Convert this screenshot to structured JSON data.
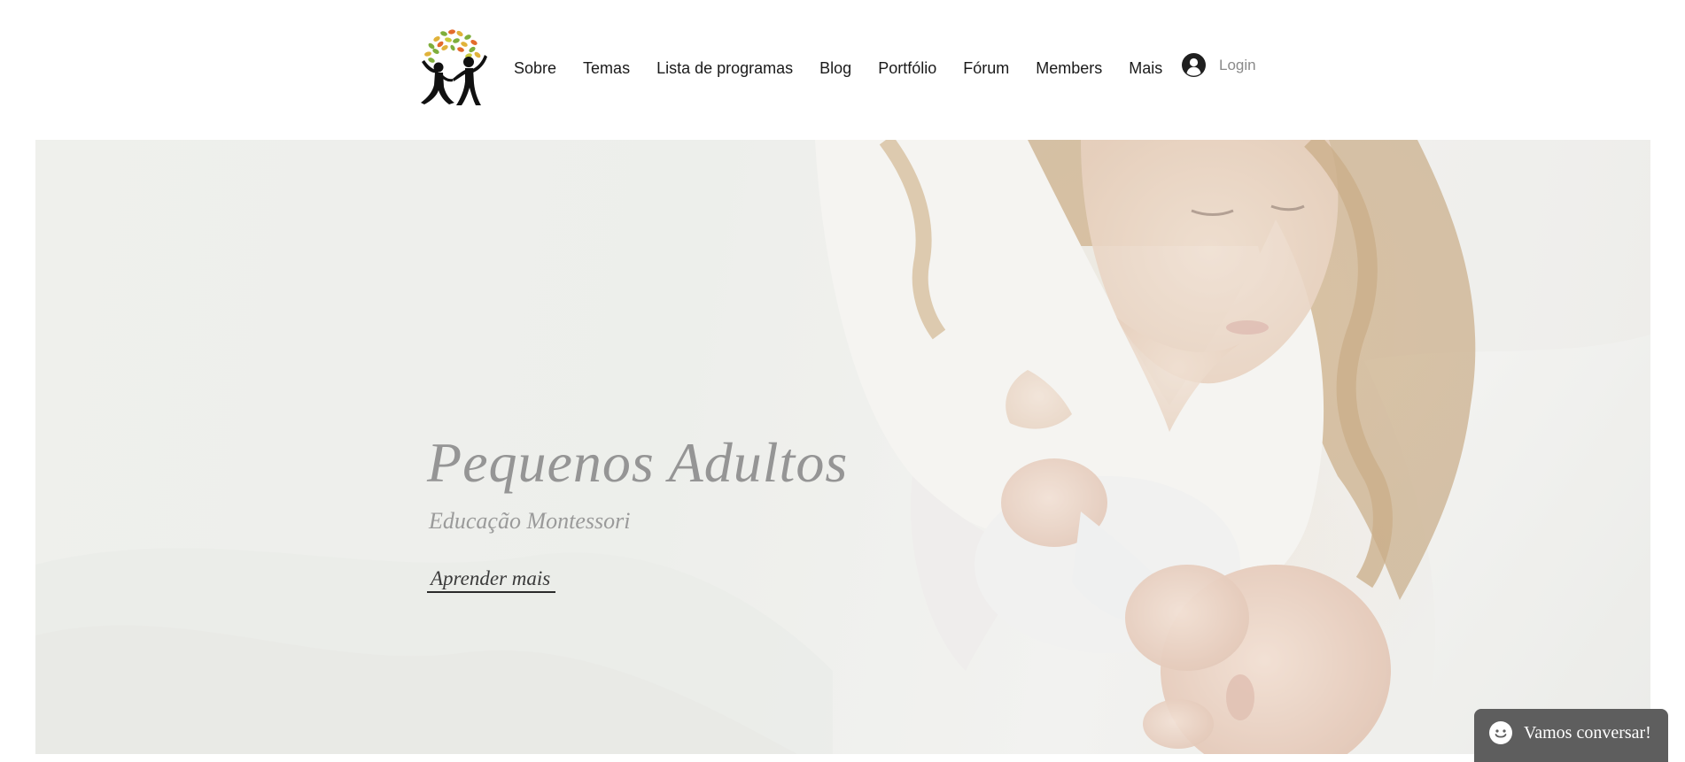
{
  "brand": {
    "logo_icon": "children-tree-logo-icon"
  },
  "nav": {
    "items": [
      {
        "label": "Sobre"
      },
      {
        "label": "Temas"
      },
      {
        "label": "Lista de programas"
      },
      {
        "label": "Blog"
      },
      {
        "label": "Portfólio"
      },
      {
        "label": "Fórum"
      },
      {
        "label": "Members"
      },
      {
        "label": "Mais"
      }
    ]
  },
  "login": {
    "icon": "user-avatar-icon",
    "label": "Login"
  },
  "hero": {
    "image": "mother-with-baby-photo",
    "title": "Pequenos Adultos",
    "subtitle": "Educação Montessori",
    "cta_label": "Aprender mais"
  },
  "chat": {
    "icon": "smiley-chat-icon",
    "label": "Vamos conversar!"
  },
  "colors": {
    "hero_title": "#959595",
    "chat_background": "#5e5e5e",
    "nav_text": "#1a1a1a",
    "login_text": "#8a8a8a"
  }
}
